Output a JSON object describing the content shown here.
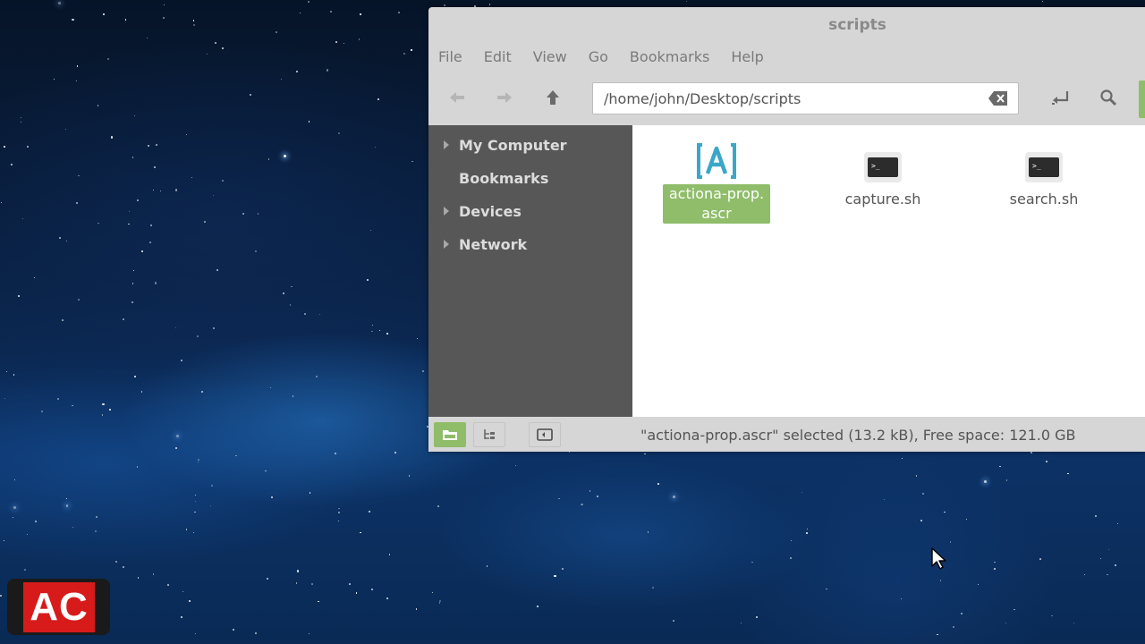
{
  "window": {
    "title": "scripts",
    "menu": [
      "File",
      "Edit",
      "View",
      "Go",
      "Bookmarks",
      "Help"
    ],
    "location_path": "/home/john/Desktop/scripts",
    "sidebar": [
      {
        "label": "My Computer",
        "expandable": true
      },
      {
        "label": "Bookmarks",
        "expandable": false
      },
      {
        "label": "Devices",
        "expandable": true
      },
      {
        "label": "Network",
        "expandable": true
      }
    ],
    "files": [
      {
        "name_line1": "actiona-prop.",
        "name_line2": "ascr",
        "icon": "actiona-script-icon",
        "selected": true
      },
      {
        "name_line1": "capture.sh",
        "icon": "terminal-script-icon",
        "selected": false
      },
      {
        "name_line1": "search.sh",
        "icon": "terminal-script-icon",
        "selected": false
      }
    ],
    "status": "\"actiona-prop.ascr\" selected (13.2 kB), Free space: 121.0 GB",
    "accent_color": "#8fbd6a",
    "sidebar_bg": "#575757"
  },
  "overlay_logo": {
    "text": "AC",
    "color": "#d71b1b"
  }
}
